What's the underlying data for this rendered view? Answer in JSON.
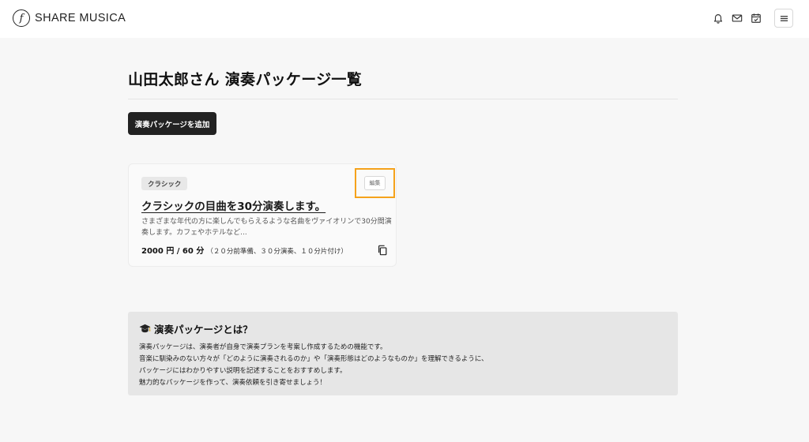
{
  "header": {
    "logo_mark": "f",
    "logo_text": "SHARE MUSICA",
    "icons": [
      "bell-icon",
      "mail-icon",
      "calendar-check-icon",
      "hamburger-menu-icon"
    ]
  },
  "page": {
    "title": "山田太郎さん 演奏パッケージ一覧",
    "add_button_label": "演奏パッケージを追加"
  },
  "package_card": {
    "tag": "クラシック",
    "edit_label": "編集",
    "title": "クラシックの目曲を30分演奏します。",
    "description": "さまざまな年代の方に楽しんでもらえるような名曲をヴァイオリンで30分間演奏します。カフェやホテルなど...",
    "price": "2000 円 / 60 分",
    "price_note": "（２０分前準備、３０分演奏、１０分片付け）",
    "copy_icon": "copy-icon"
  },
  "info": {
    "icon": "graduation-cap-icon",
    "title": "演奏パッケージとは？",
    "lines": [
      "演奏パッケージは、演奏者が自身で演奏プランを考案し作成するための機能です。",
      "音楽に馴染みのない方々が「どのように演奏されるのか」や「演奏形態はどのようなものか」を理解できるように、",
      "パッケージにはわかりやすい説明を記述することをおすすめします。",
      "魅力的なパッケージを作って、演奏依頼を引き寄せましょう！"
    ]
  },
  "colors": {
    "accent_highlight": "#f5a21b",
    "primary_button": "#222222",
    "background": "#f7f7f7"
  }
}
